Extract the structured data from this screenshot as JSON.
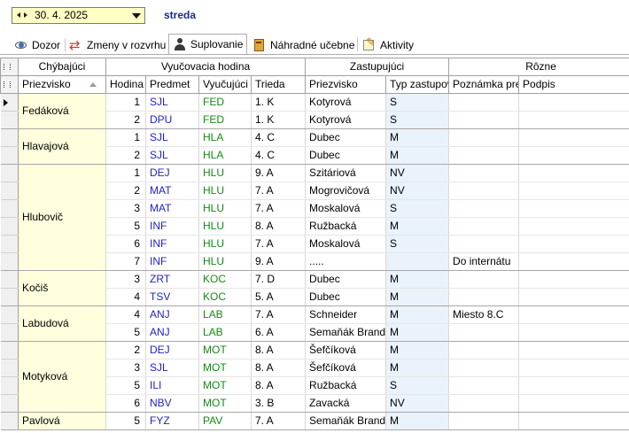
{
  "date": {
    "value": "30. 4. 2025",
    "day_name": "streda"
  },
  "tabs": [
    {
      "label": "Dozor",
      "icon": "eye-icon"
    },
    {
      "label": "Zmeny v rozvrhu",
      "icon": "swap-icon"
    },
    {
      "label": "Suplovanie",
      "icon": "user-icon"
    },
    {
      "label": "Náhradné učebne",
      "icon": "book-icon"
    },
    {
      "label": "Aktivity",
      "icon": "activity-icon"
    }
  ],
  "active_tab": "Suplovanie",
  "bands": {
    "absent": "Chýbajúci",
    "lesson": "Vyučovacia hodina",
    "substitute": "Zastupujúci",
    "other": "Rôzne"
  },
  "columns": {
    "absent_surname": "Priezvisko",
    "hour": "Hodina",
    "subject": "Predmet",
    "teacher": "Vyučujúci",
    "class": "Trieda",
    "sub_surname": "Priezvisko",
    "sub_type": "Typ zastupovania",
    "note": "Poznámka pre",
    "signature": "Podpis"
  },
  "groups": [
    {
      "absent": "Fedáková",
      "rows": [
        {
          "hour": "1",
          "subject": "SJL",
          "teacher": "FED",
          "class": "1. K",
          "substitute": "Kotyrová",
          "type": "S",
          "note": "",
          "signature": ""
        },
        {
          "hour": "2",
          "subject": "DPU",
          "teacher": "FED",
          "class": "1. K",
          "substitute": "Kotyrová",
          "type": "S",
          "note": "",
          "signature": ""
        }
      ]
    },
    {
      "absent": "Hlavajová",
      "rows": [
        {
          "hour": "1",
          "subject": "SJL",
          "teacher": "HLA",
          "class": "4. C",
          "substitute": "Dubec",
          "type": "M",
          "note": "",
          "signature": ""
        },
        {
          "hour": "2",
          "subject": "SJL",
          "teacher": "HLA",
          "class": "4. C",
          "substitute": "Dubec",
          "type": "M",
          "note": "",
          "signature": ""
        }
      ]
    },
    {
      "absent": "Hlubovič",
      "rows": [
        {
          "hour": "1",
          "subject": "DEJ",
          "teacher": "HLU",
          "class": "9. A",
          "substitute": "Szitáriová",
          "type": "NV",
          "note": "",
          "signature": ""
        },
        {
          "hour": "2",
          "subject": "MAT",
          "teacher": "HLU",
          "class": "7. A",
          "substitute": "Mogrovičová",
          "type": "NV",
          "note": "",
          "signature": ""
        },
        {
          "hour": "3",
          "subject": "MAT",
          "teacher": "HLU",
          "class": "7. A",
          "substitute": "Moskalová",
          "type": "S",
          "note": "",
          "signature": ""
        },
        {
          "hour": "5",
          "subject": "INF",
          "teacher": "HLU",
          "class": "8. A",
          "substitute": "Ružbacká",
          "type": "M",
          "note": "",
          "signature": ""
        },
        {
          "hour": "6",
          "subject": "INF",
          "teacher": "HLU",
          "class": "7. A",
          "substitute": "Moskalová",
          "type": "S",
          "note": "",
          "signature": ""
        },
        {
          "hour": "7",
          "subject": "INF",
          "teacher": "HLU",
          "class": "9. A",
          "substitute": ".....",
          "type": "",
          "note": "Do internátu",
          "signature": ""
        }
      ]
    },
    {
      "absent": "Kočiš",
      "rows": [
        {
          "hour": "3",
          "subject": "ZRT",
          "teacher": "KOC",
          "class": "7. D",
          "substitute": "Dubec",
          "type": "M",
          "note": "",
          "signature": ""
        },
        {
          "hour": "4",
          "subject": "TSV",
          "teacher": "KOC",
          "class": "5. A",
          "substitute": "Dubec",
          "type": "M",
          "note": "",
          "signature": ""
        }
      ]
    },
    {
      "absent": "Labudová",
      "rows": [
        {
          "hour": "4",
          "subject": "ANJ",
          "teacher": "LAB",
          "class": "7. A",
          "substitute": "Schneider",
          "type": "M",
          "note": "Miesto 8.C",
          "signature": ""
        },
        {
          "hour": "5",
          "subject": "ANJ",
          "teacher": "LAB",
          "class": "6. A",
          "substitute": "Semaňák Brandon",
          "type": "M",
          "note": "",
          "signature": ""
        }
      ]
    },
    {
      "absent": "Motyková",
      "rows": [
        {
          "hour": "2",
          "subject": "DEJ",
          "teacher": "MOT",
          "class": "8. A",
          "substitute": "Šefčíková",
          "type": "M",
          "note": "",
          "signature": ""
        },
        {
          "hour": "3",
          "subject": "SJL",
          "teacher": "MOT",
          "class": "8. A",
          "substitute": "Šefčíková",
          "type": "M",
          "note": "",
          "signature": ""
        },
        {
          "hour": "5",
          "subject": "ILI",
          "teacher": "MOT",
          "class": "8. A",
          "substitute": "Ružbacká",
          "type": "S",
          "note": "",
          "signature": ""
        },
        {
          "hour": "6",
          "subject": "NBV",
          "teacher": "MOT",
          "class": "3. B",
          "substitute": "Zavacká",
          "type": "NV",
          "note": "",
          "signature": ""
        }
      ]
    },
    {
      "absent": "Pavlová",
      "rows": [
        {
          "hour": "5",
          "subject": "FYZ",
          "teacher": "PAV",
          "class": "7. A",
          "substitute": "Semaňák Brandon",
          "type": "M",
          "note": "",
          "signature": ""
        }
      ]
    }
  ]
}
